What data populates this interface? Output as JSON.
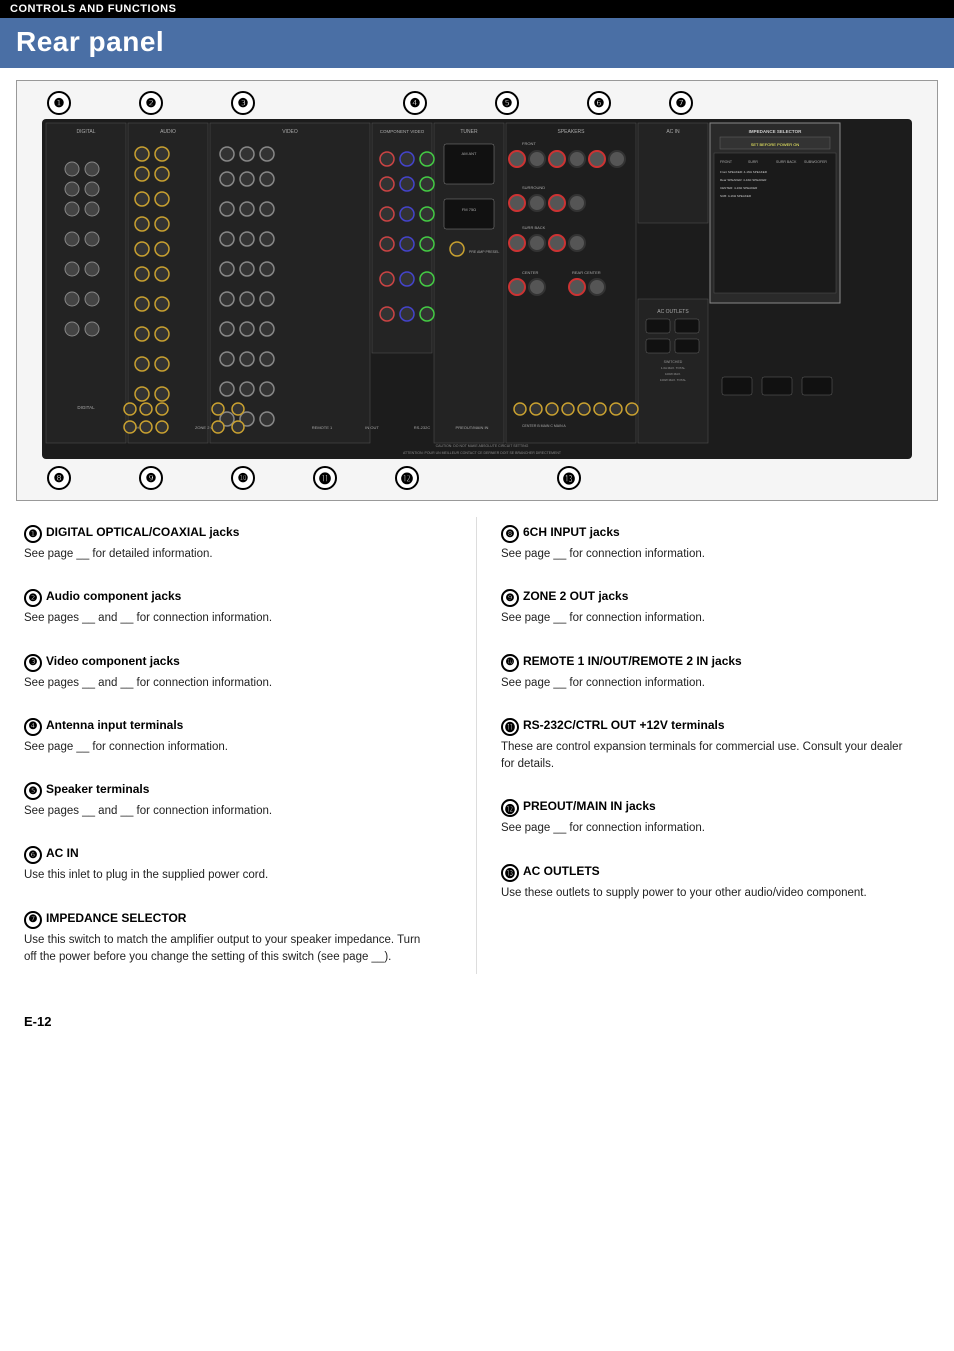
{
  "header": {
    "title": "CONTROLS AND FUNCTIONS"
  },
  "page_title": "Rear panel",
  "callouts_top": [
    "❶",
    "❷",
    "❸",
    "❹",
    "❺",
    "❻",
    "❼"
  ],
  "callouts_bottom": [
    "❽",
    "❾",
    "❿",
    "⓫",
    "⓬",
    "⓭"
  ],
  "descriptions": [
    {
      "num": "1",
      "title": "DIGITAL OPTICAL/COAXIAL jacks",
      "text": "See page __ for detailed information."
    },
    {
      "num": "2",
      "title": "Audio component jacks",
      "text": "See pages __ and __ for connection information."
    },
    {
      "num": "3",
      "title": "Video component jacks",
      "text": "See pages __ and __ for connection information."
    },
    {
      "num": "4",
      "title": "Antenna input terminals",
      "text": "See page __ for connection information."
    },
    {
      "num": "5",
      "title": "Speaker terminals",
      "text": "See pages __ and __ for connection information."
    },
    {
      "num": "6",
      "title": "AC IN",
      "text": "Use this inlet to plug in the supplied power cord."
    },
    {
      "num": "7",
      "title": "IMPEDANCE SELECTOR",
      "text": "Use this switch to match the amplifier output to your speaker impedance. Turn off the power before you change the setting of this switch (see page __)."
    },
    {
      "num": "8",
      "title": "6CH INPUT jacks",
      "text": "See page __ for connection information."
    },
    {
      "num": "9",
      "title": "ZONE 2 OUT jacks",
      "text": "See page __ for connection information."
    },
    {
      "num": "10",
      "title": "REMOTE 1 IN/OUT/REMOTE 2 IN jacks",
      "text": "See page __ for connection information."
    },
    {
      "num": "11",
      "title": "RS-232C/CTRL OUT +12V terminals",
      "text": "These are control expansion terminals for commercial use. Consult your dealer for details."
    },
    {
      "num": "12",
      "title": "PREOUT/MAIN IN jacks",
      "text": "See page __ for connection information."
    },
    {
      "num": "13",
      "title": "AC OUTLETS",
      "text": "Use these outlets to supply power to your other audio/video component."
    }
  ],
  "page_number": "E-12"
}
